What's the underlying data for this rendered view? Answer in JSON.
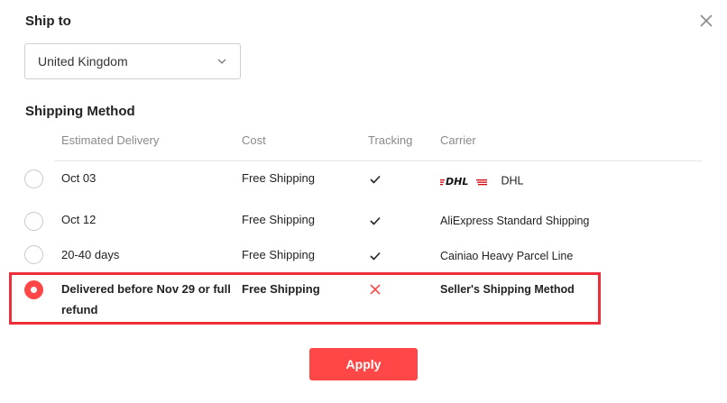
{
  "dialog": {
    "close_icon": "close-icon"
  },
  "ship_to": {
    "title": "Ship to",
    "selected_country": "United Kingdom"
  },
  "shipping_method": {
    "title": "Shipping Method",
    "columns": [
      "Estimated Delivery",
      "Cost",
      "Tracking",
      "Carrier"
    ],
    "rows": [
      {
        "delivery": "Oct 03",
        "cost": "Free Shipping",
        "tracking": "check",
        "carrier": "DHL",
        "carrier_logo": "DHL",
        "selected": false
      },
      {
        "delivery": "Oct 12",
        "cost": "Free Shipping",
        "tracking": "check",
        "carrier": "AliExpress Standard Shipping",
        "selected": false
      },
      {
        "delivery": "20-40 days",
        "cost": "Free Shipping",
        "tracking": "check",
        "carrier": "Cainiao Heavy Parcel Line",
        "selected": false
      },
      {
        "delivery": "Delivered before Nov 29 or full refund",
        "cost": "Free Shipping",
        "tracking": "cross",
        "carrier": "Seller's Shipping Method",
        "selected": true
      }
    ]
  },
  "apply_label": "Apply",
  "colors": {
    "accent": "#ff4747",
    "highlight_border": "#ee2e3a",
    "dhl_red": "#d40511",
    "cross": "#ff4747"
  }
}
